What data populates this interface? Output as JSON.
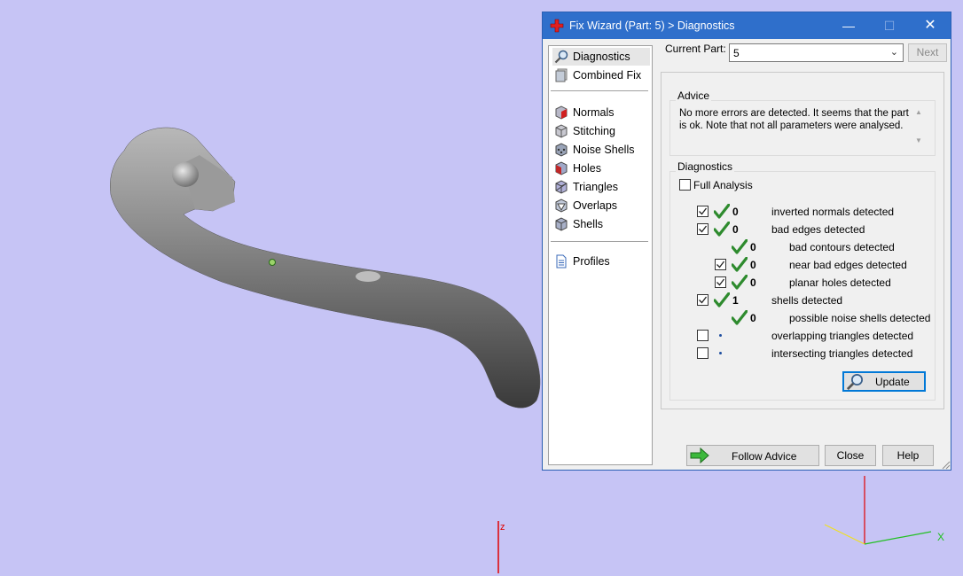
{
  "window": {
    "title": "Fix Wizard (Part: 5) > Diagnostics",
    "minimize": "—",
    "maximize": "☐",
    "close": "✕"
  },
  "nav": {
    "items": [
      {
        "label": "Diagnostics",
        "icon": "magnifier-icon"
      },
      {
        "label": "Combined Fix",
        "icon": "combined-fix-icon"
      },
      {
        "label": "Normals",
        "icon": "normals-cube-icon"
      },
      {
        "label": "Stitching",
        "icon": "stitching-cube-icon"
      },
      {
        "label": "Noise Shells",
        "icon": "noise-shells-cube-icon"
      },
      {
        "label": "Holes",
        "icon": "holes-cube-icon"
      },
      {
        "label": "Triangles",
        "icon": "triangles-cube-icon"
      },
      {
        "label": "Overlaps",
        "icon": "overlaps-cube-icon"
      },
      {
        "label": "Shells",
        "icon": "shells-cube-icon"
      },
      {
        "label": "Profiles",
        "icon": "profiles-document-icon"
      }
    ]
  },
  "current_part": {
    "label": "Current Part:",
    "value": "5",
    "next": "Next"
  },
  "advice": {
    "title": "Advice",
    "text": "No more errors are detected. It seems that the part is ok. Note that not all parameters were analysed."
  },
  "diagnostics": {
    "title": "Diagnostics",
    "full_analysis": "Full Analysis",
    "rows": [
      {
        "checkbox": true,
        "checked": true,
        "status": "ok",
        "count": "0",
        "label": "inverted normals detected"
      },
      {
        "checkbox": true,
        "checked": true,
        "status": "ok",
        "count": "0",
        "label": "bad edges detected"
      },
      {
        "checkbox": false,
        "checked": false,
        "status": "ok",
        "count": "0",
        "label": "bad contours detected"
      },
      {
        "checkbox": true,
        "checked": true,
        "status": "ok",
        "count": "0",
        "label": "near bad edges detected"
      },
      {
        "checkbox": true,
        "checked": true,
        "status": "ok",
        "count": "0",
        "label": "planar holes detected"
      },
      {
        "checkbox": true,
        "checked": true,
        "status": "ok",
        "count": "1",
        "label": "shells detected"
      },
      {
        "checkbox": false,
        "checked": false,
        "status": "ok",
        "count": "0",
        "label": "possible noise shells detected"
      },
      {
        "checkbox": true,
        "checked": false,
        "status": "none",
        "count": "",
        "label": "overlapping triangles detected"
      },
      {
        "checkbox": true,
        "checked": false,
        "status": "none",
        "count": "",
        "label": "intersecting triangles detected"
      }
    ],
    "update": "Update"
  },
  "footer": {
    "follow_advice": "Follow Advice",
    "close": "Close",
    "help": "Help"
  },
  "axes": {
    "z_label": "z",
    "x_label": "X"
  },
  "colors": {
    "background": "#c6c4f5",
    "titlebar": "#2f6fcb",
    "ok_green": "#2e8b2e",
    "part_gray": "#8a8a8a"
  }
}
